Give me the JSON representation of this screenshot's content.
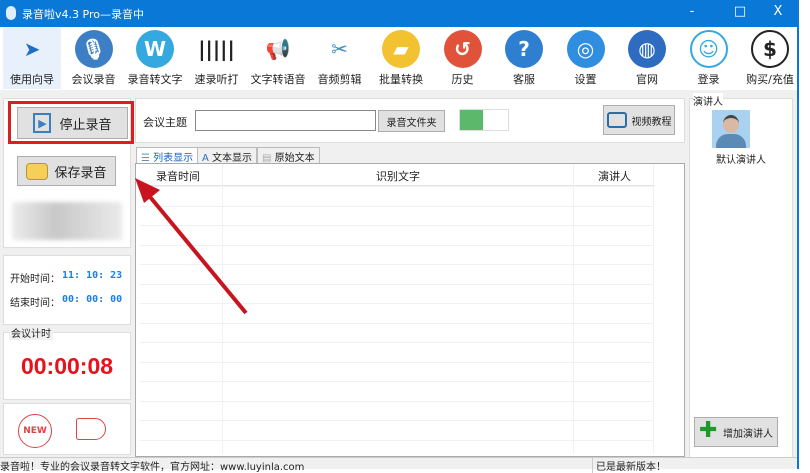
{
  "window": {
    "title": "录音啦v4.3 Pro—录音中",
    "minimize": "-",
    "maximize": "□",
    "close": "X"
  },
  "toolbar": [
    {
      "label": "使用向导",
      "icon": "navigation-arrow-icon",
      "color": "#1e6fc8"
    },
    {
      "label": "会议录音",
      "icon": "microphone-icon",
      "color": "#3d7fc4"
    },
    {
      "label": "录音转文字",
      "icon": "w-logo-icon",
      "color": "#35a8e0"
    },
    {
      "label": "速录听打",
      "icon": "waveform-icon",
      "color": "#222222"
    },
    {
      "label": "文字转语音",
      "icon": "megaphone-icon",
      "color": "#d84a4a"
    },
    {
      "label": "音频剪辑",
      "icon": "scissors-icon",
      "color": "#3a8fc0"
    },
    {
      "label": "批量转换",
      "icon": "folder-icon",
      "color": "#f2c230"
    },
    {
      "label": "历史",
      "icon": "history-clock-icon",
      "color": "#e0533a"
    },
    {
      "label": "客服",
      "icon": "help-icon",
      "color": "#2f7fd0"
    },
    {
      "label": "设置",
      "icon": "lifebuoy-icon",
      "color": "#2f8ee0"
    },
    {
      "label": "官网",
      "icon": "globe-icon",
      "color": "#2d6cc0"
    },
    {
      "label": "登录",
      "icon": "user-icon",
      "color": "#35a8e0"
    },
    {
      "label": "购买/充值",
      "icon": "dollar-icon",
      "color": "#222222"
    }
  ],
  "left": {
    "stop_label": "停止录音",
    "save_label": "保存录音",
    "start_label": "开始时间：",
    "start_value": "11: 10: 23",
    "end_label": "结束时间：",
    "end_value": "00: 00: 00",
    "timer_label": "会议计时",
    "timer_value": "00:00:08",
    "new_badge": "NEW"
  },
  "center": {
    "topic_label": "会议主题",
    "topic_value": "",
    "folder_button": "录音文件夹",
    "video_button": "视频教程",
    "tabs": [
      "列表显示",
      "文本显示",
      "原始文本"
    ],
    "columns": [
      "录音时间",
      "识别文字",
      "演讲人"
    ]
  },
  "right": {
    "group_label": "演讲人",
    "default_speaker": "默认演讲人",
    "add_button": "增加演讲人"
  },
  "status": {
    "left": "录音啦！专业的会议录音转文字软件，官方网址：www.luyinla.com",
    "right": "已是最新版本！"
  }
}
